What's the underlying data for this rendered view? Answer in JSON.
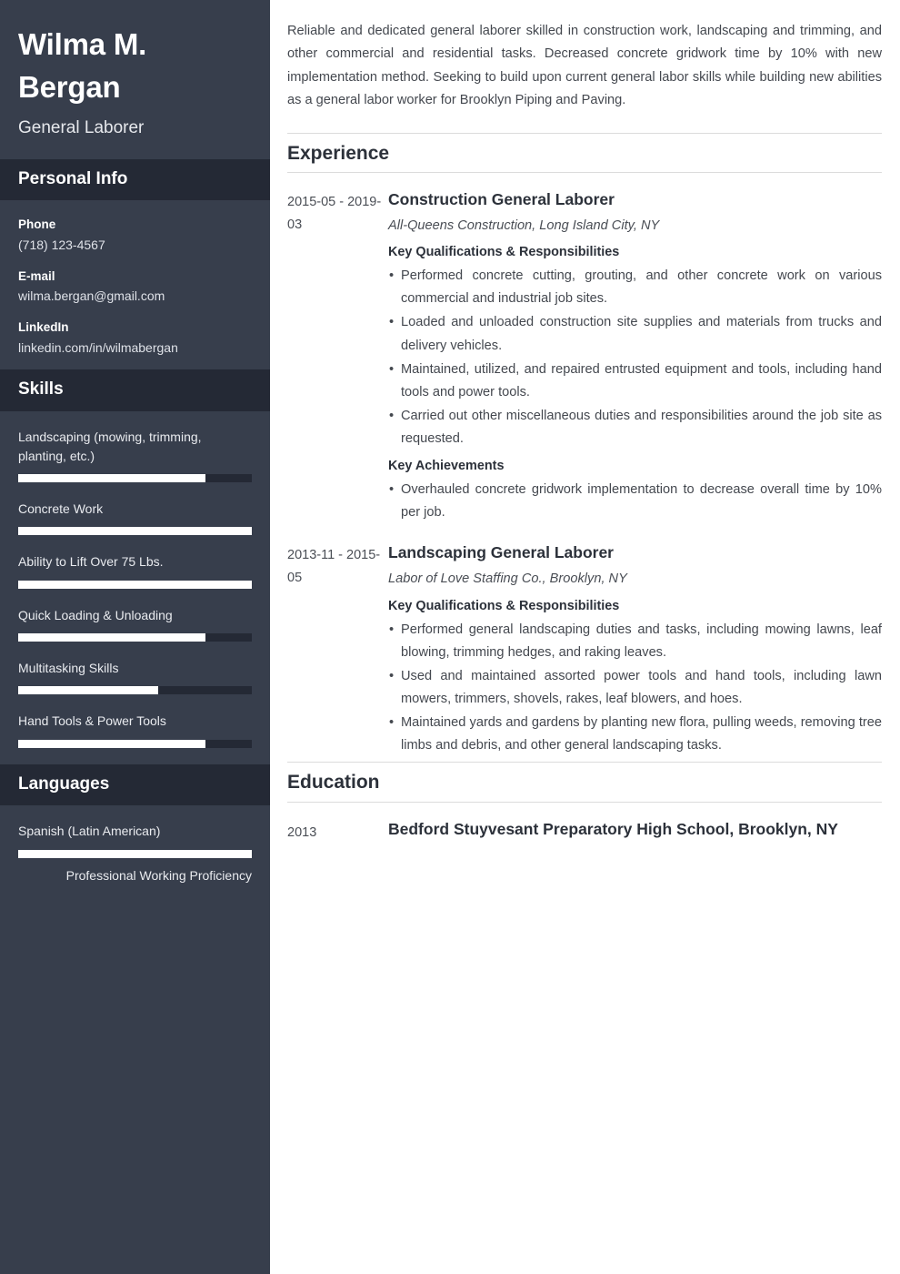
{
  "sidebar": {
    "name": "Wilma M. Bergan",
    "job_title": "General Laborer",
    "personal_info": {
      "heading": "Personal Info",
      "items": [
        {
          "label": "Phone",
          "value": "(718) 123-4567"
        },
        {
          "label": "E-mail",
          "value": "wilma.bergan@gmail.com"
        },
        {
          "label": "LinkedIn",
          "value": "linkedin.com/in/wilmabergan"
        }
      ]
    },
    "skills": {
      "heading": "Skills",
      "items": [
        {
          "name": "Landscaping (mowing, trimming, planting, etc.)",
          "level": 80
        },
        {
          "name": "Concrete Work",
          "level": 100
        },
        {
          "name": "Ability to Lift Over 75 Lbs.",
          "level": 100
        },
        {
          "name": "Quick Loading & Unloading",
          "level": 80
        },
        {
          "name": "Multitasking Skills",
          "level": 60
        },
        {
          "name": "Hand Tools & Power Tools",
          "level": 80
        }
      ]
    },
    "languages": {
      "heading": "Languages",
      "items": [
        {
          "name": "Spanish (Latin American)",
          "level": 100,
          "proficiency": "Professional Working Proficiency"
        }
      ]
    }
  },
  "main": {
    "summary": "Reliable and dedicated general laborer skilled in construction work, landscaping and trimming, and other commercial and residential tasks. Decreased concrete gridwork time by 10% with new implementation method. Seeking to build upon current general labor skills while building new abilities as a general labor worker for Brooklyn Piping and Paving.",
    "experience": {
      "heading": "Experience",
      "entries": [
        {
          "dates": "2015-05 - 2019-03",
          "title": "Construction General Laborer",
          "org": "All-Queens Construction, Long Island City, NY",
          "qualifications_label": "Key Qualifications & Responsibilities",
          "qualifications": [
            "Performed concrete cutting, grouting, and other concrete work on various commercial and industrial job sites.",
            "Loaded and unloaded construction site supplies and materials from trucks and delivery vehicles.",
            "Maintained, utilized, and repaired entrusted equipment and tools, including hand tools and power tools.",
            "Carried out other miscellaneous duties and responsibilities around the job site as requested."
          ],
          "achievements_label": "Key Achievements",
          "achievements": [
            "Overhauled concrete gridwork implementation to decrease overall time by 10% per job."
          ]
        },
        {
          "dates": "2013-11 - 2015-05",
          "title": "Landscaping General Laborer",
          "org": "Labor of Love Staffing Co., Brooklyn, NY",
          "qualifications_label": "Key Qualifications & Responsibilities",
          "qualifications": [
            "Performed general landscaping duties and tasks, including mowing lawns, leaf blowing, trimming hedges, and raking leaves.",
            "Used and maintained assorted power tools and hand tools, including lawn mowers, trimmers, shovels, rakes, leaf blowers, and hoes.",
            "Maintained yards and gardens by planting new flora, pulling weeds, removing tree limbs and debris, and other general landscaping tasks."
          ],
          "achievements_label": "",
          "achievements": []
        }
      ]
    },
    "education": {
      "heading": "Education",
      "entries": [
        {
          "dates": "2013",
          "title": "Bedford Stuyvesant Preparatory High School, Brooklyn, NY"
        }
      ]
    }
  },
  "colors": {
    "sidebar_bg": "#373e4c",
    "sidebar_band_bg": "#242935",
    "bar_fill": "#ffffff",
    "bar_track": "#242935",
    "text_dark": "#2c313a"
  }
}
